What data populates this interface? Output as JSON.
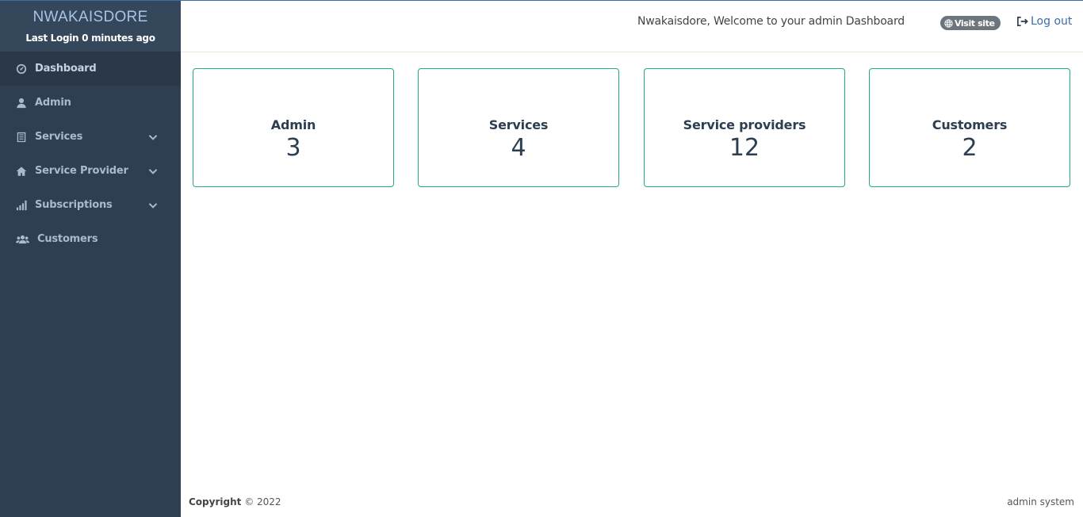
{
  "sidebar": {
    "brand": "NWAKAISDORE",
    "last_login": "Last Login 0 minutes ago",
    "items": [
      {
        "label": "Dashboard",
        "icon": "dashboard-icon"
      },
      {
        "label": "Admin",
        "icon": "user-icon"
      },
      {
        "label": "Services",
        "icon": "list-icon",
        "expandable": true
      },
      {
        "label": "Service Provider",
        "icon": "home-icon",
        "expandable": true
      },
      {
        "label": "Subscriptions",
        "icon": "bar-signal-icon",
        "expandable": true
      },
      {
        "label": "Customers",
        "icon": "users-icon"
      }
    ]
  },
  "header": {
    "welcome": "Nwakaisdore, Welcome to your admin Dashboard",
    "visit_site": "Visit site",
    "logout": "Log out"
  },
  "cards": [
    {
      "title": "Admin",
      "value": "3"
    },
    {
      "title": "Services",
      "value": "4"
    },
    {
      "title": "Service providers",
      "value": "12"
    },
    {
      "title": "Customers",
      "value": "2"
    }
  ],
  "footer": {
    "copyright_label": "Copyright",
    "copyright_year": "© 2022",
    "right": "admin system"
  },
  "colors": {
    "sidebar_bg": "#2f3f52",
    "card_border": "#22a88a",
    "link": "#3b6ca8",
    "badge": "#6c757d"
  }
}
